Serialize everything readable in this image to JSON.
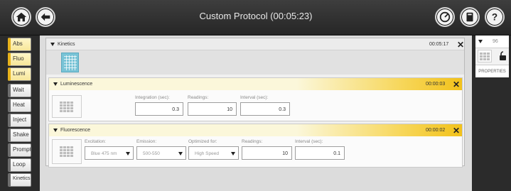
{
  "header": {
    "title": "Custom Protocol (00:05:23)"
  },
  "sidebar": {
    "items": [
      {
        "label": "Abs",
        "kind": "read"
      },
      {
        "label": "Fluo",
        "kind": "read"
      },
      {
        "label": "Lumi",
        "kind": "read"
      },
      {
        "label": "Wait",
        "kind": "action"
      },
      {
        "label": "Heat",
        "kind": "action"
      },
      {
        "label": "Inject",
        "kind": "action"
      },
      {
        "label": "Shake",
        "kind": "action"
      },
      {
        "label": "Prompt",
        "kind": "action"
      },
      {
        "label": "Loop",
        "kind": "action"
      },
      {
        "label": "Kinetics",
        "kind": "action"
      }
    ]
  },
  "kinetics": {
    "title": "Kinetics",
    "time": "00:05:17",
    "close": "✕"
  },
  "luminescence": {
    "title": "Luminescence",
    "time": "00:00:03",
    "close": "✕",
    "integration_label": "Integration (sec):",
    "integration_value": "0.3",
    "readings_label": "Readings:",
    "readings_value": "10",
    "interval_label": "Interval (sec):",
    "interval_value": "0.3"
  },
  "fluorescence": {
    "title": "Fluorescence",
    "time": "00:00:02",
    "close": "✕",
    "excitation_label": "Excitation:",
    "excitation_value": "Blue 475 nm",
    "emission_label": "Emission:",
    "emission_value": "500-550",
    "optimized_label": "Optimized for:",
    "optimized_value": "High Speed",
    "readings_label": "Readings:",
    "readings_value": "10",
    "interval_label": "Interval (sec):",
    "interval_value": "0.1"
  },
  "right_panel": {
    "plate": "96",
    "properties": "PROPERTIES"
  },
  "colors": {
    "accent_yellow": "#f2c21b",
    "kinetics_teal": "#79c3d6",
    "bar_dark": "#2b2b2b"
  }
}
